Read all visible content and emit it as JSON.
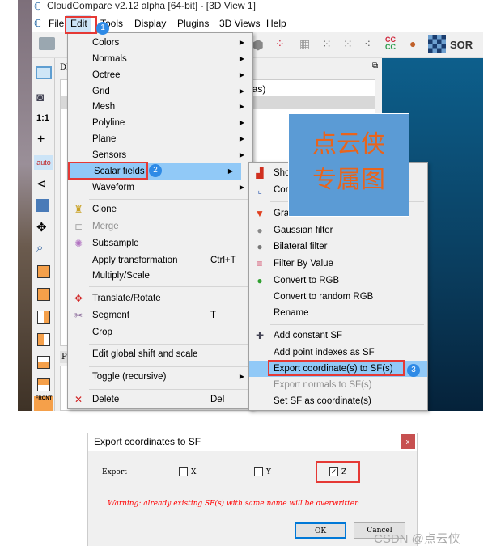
{
  "window": {
    "title": "CloudCompare v2.12 alpha [64-bit] - [3D View 1]"
  },
  "menubar": [
    "File",
    "Edit",
    "Tools",
    "Display",
    "Plugins",
    "3D Views",
    "Help"
  ],
  "db_panel": {
    "header": "DB Tree",
    "tree_item_fragment": "las)",
    "properties_tab": "Pr"
  },
  "left_toolbar": {
    "zoom_label": "1:1",
    "auto_label": "auto",
    "front_label": "FRONT"
  },
  "toolbar": {
    "sor_label": "SOR",
    "cc_label": "CC"
  },
  "edit_menu": [
    {
      "label": "Colors",
      "submenu": true
    },
    {
      "label": "Normals",
      "submenu": true
    },
    {
      "label": "Octree",
      "submenu": true
    },
    {
      "label": "Grid",
      "submenu": true
    },
    {
      "label": "Mesh",
      "submenu": true
    },
    {
      "label": "Polyline",
      "submenu": true
    },
    {
      "label": "Plane",
      "submenu": true
    },
    {
      "label": "Sensors",
      "submenu": true
    },
    {
      "label": "Scalar fields",
      "submenu": true,
      "highlighted": true
    },
    {
      "label": "Waveform",
      "submenu": true
    },
    {
      "label": "Clone"
    },
    {
      "label": "Merge",
      "disabled": true
    },
    {
      "label": "Subsample"
    },
    {
      "label": "Apply transformation",
      "shortcut": "Ctrl+T"
    },
    {
      "label": "Multiply/Scale"
    },
    {
      "label": "Translate/Rotate"
    },
    {
      "label": "Segment",
      "shortcut": "T"
    },
    {
      "label": "Crop"
    },
    {
      "label": "Edit global shift and scale"
    },
    {
      "label": "Toggle (recursive)",
      "submenu": true
    },
    {
      "label": "Delete",
      "shortcut": "Del"
    }
  ],
  "scalar_fields_menu": [
    {
      "label": "Sho"
    },
    {
      "label": "Cor"
    },
    {
      "label": "Gra"
    },
    {
      "label": "Gaussian filter"
    },
    {
      "label": "Bilateral filter"
    },
    {
      "label": "Filter By Value"
    },
    {
      "label": "Convert to RGB"
    },
    {
      "label": "Convert to random RGB"
    },
    {
      "label": "Rename"
    },
    {
      "label": "Add constant SF"
    },
    {
      "label": "Add point indexes as SF"
    },
    {
      "label": "Export coordinate(s) to SF(s)",
      "highlighted": true
    },
    {
      "label": "Export normals to SF(s)",
      "disabled": true
    },
    {
      "label": "Set SF as coordinate(s)"
    }
  ],
  "steps": [
    "1",
    "2",
    "3"
  ],
  "watermark": {
    "line1": "点云侠",
    "line2": "专属图"
  },
  "dialog": {
    "title": "Export coordinates to SF",
    "close": "x",
    "export_label": "Export",
    "options": [
      {
        "label": "X",
        "checked": false
      },
      {
        "label": "Y",
        "checked": false
      },
      {
        "label": "Z",
        "checked": true
      }
    ],
    "warning": "Warning: already existing SF(s) with same name will be overwritten",
    "ok": "OK",
    "cancel": "Cancel"
  },
  "credit": "CSDN @点云侠",
  "colors": {
    "highlight": "#91c9f7",
    "annotation_red": "#e53935",
    "badge_blue": "#2e8ae6",
    "warning_red": "#ff0000",
    "watermark_bg": "#5b9bd5",
    "watermark_text": "#e8641c"
  }
}
